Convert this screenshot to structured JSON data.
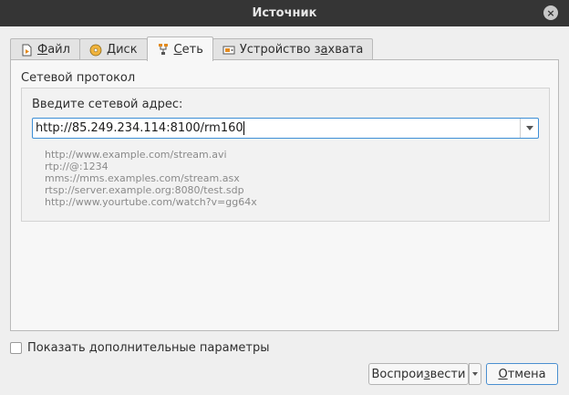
{
  "window": {
    "title": "Источник",
    "close_icon": "×"
  },
  "tabs": [
    {
      "pre": "",
      "accel": "Ф",
      "post": "айл",
      "icon": "file-icon",
      "active": false
    },
    {
      "pre": "",
      "accel": "Д",
      "post": "иск",
      "icon": "disc-icon",
      "active": false
    },
    {
      "pre": "",
      "accel": "С",
      "post": "еть",
      "icon": "network-icon",
      "active": true
    },
    {
      "pre": "Устройство з",
      "accel": "а",
      "post": "хвата",
      "icon": "capture-device-icon",
      "active": false
    }
  ],
  "network": {
    "group_title": "Сетевой протокол",
    "prompt": "Введите сетевой адрес:",
    "url_value": "http://85.249.234.114:8100/rm160",
    "examples": [
      "http://www.example.com/stream.avi",
      "rtp://@:1234",
      "mms://mms.examples.com/stream.asx",
      "rtsp://server.example.org:8080/test.sdp",
      "http://www.yourtube.com/watch?v=gg64x"
    ]
  },
  "options": {
    "show_more_label": "Показать дополнительные параметры",
    "checked": false
  },
  "buttons": {
    "play_pre": "Воспрои",
    "play_accel": "з",
    "play_post": "вести",
    "cancel_accel": "О",
    "cancel_post": "тмена"
  },
  "colors": {
    "titlebar": "#353535",
    "focus": "#3d8fd6",
    "panel": "#f7f7f7"
  }
}
